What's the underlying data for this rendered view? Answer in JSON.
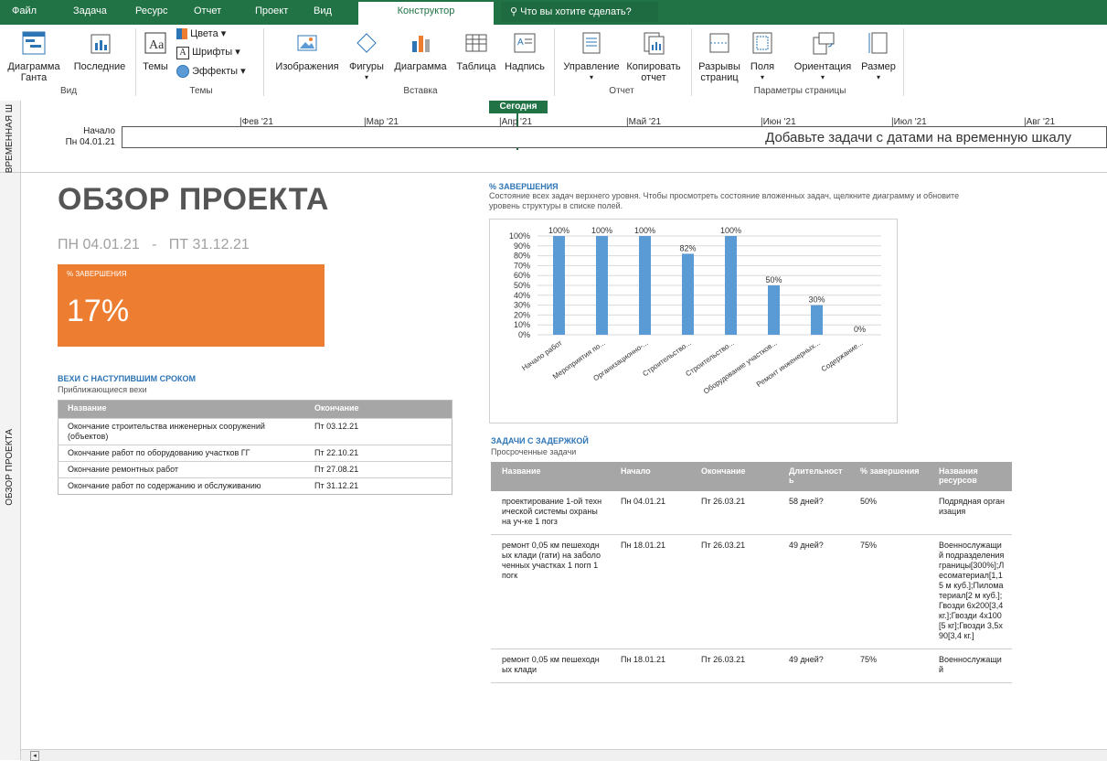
{
  "tabs": [
    "Файл",
    "Задача",
    "Ресурс",
    "Отчет",
    "Проект",
    "Вид",
    "Конструктор"
  ],
  "active_tab": "Конструктор",
  "tellme": "Что вы хотите сделать?",
  "ribbon": {
    "gantt": "Диаграмма Ганта",
    "recent": "Последние",
    "themes": "Темы",
    "colors": "Цвета",
    "fonts": "Шрифты",
    "effects": "Эффекты",
    "images": "Изображения",
    "shapes": "Фигуры",
    "chart": "Диаграмма",
    "table": "Таблица",
    "textbox": "Надпись",
    "manage": "Управление",
    "copy": "Копировать отчет",
    "breaks": "Разрывы страниц",
    "margins": "Поля",
    "orientation": "Ориентация",
    "size": "Размер",
    "groups": {
      "view": "Вид",
      "themes": "Темы",
      "insert": "Вставка",
      "report": "Отчет",
      "page": "Параметры страницы"
    }
  },
  "timeline": {
    "side_label": "ВРЕМЕННАЯ Ш",
    "today": "Сегодня",
    "start_label": "Начало",
    "start_date": "Пн 04.01.21",
    "months": [
      "Фев '21",
      "Мар '21",
      "Апр '21",
      "Май '21",
      "Июн '21",
      "Июл '21",
      "Авг '21"
    ],
    "placeholder": "Добавьте задачи с датами на временную шкалу"
  },
  "report": {
    "side_label": "ОБЗОР ПРОЕКТА",
    "title": "ОБЗОР ПРОЕКТА",
    "date_start": "ПН 04.01.21",
    "date_sep": "-",
    "date_end": "ПТ 31.12.21",
    "complete_label": "% ЗАВЕРШЕНИЯ",
    "complete_value": "17%",
    "accent_color": "#ed7d31",
    "milestones": {
      "title": "ВЕХИ С НАСТУПИВШИМ СРОКОМ",
      "subtitle": "Приближающиеся вехи",
      "headers": [
        "Название",
        "Окончание"
      ],
      "rows": [
        [
          "Окончание строительства инженерных сооружений (объектов)",
          "Пт 03.12.21"
        ],
        [
          "Окончание работ по оборудованию участков ГГ",
          "Пт 22.10.21"
        ],
        [
          "Окончание ремонтных работ",
          "Пт 27.08.21"
        ],
        [
          "Окончание работ по содержанию и обслуживанию",
          "Пт 31.12.21"
        ]
      ]
    },
    "chart_title": "% ЗАВЕРШЕНИЯ",
    "chart_desc": "Состояние всех задач верхнего уровня. Чтобы просмотреть состояние вложенных задач, щелкните диаграмму и обновите уровень структуры в списке полей.",
    "late": {
      "title": "ЗАДАЧИ С ЗАДЕРЖКОЙ",
      "subtitle": "Просроченные задачи",
      "headers": [
        "Название",
        "Начало",
        "Окончание",
        "Длительность",
        "% завершения",
        "Названия ресурсов"
      ],
      "rows": [
        [
          "проектирование 1-ой технической системы охраны на уч-ке 1 погз",
          "Пн 04.01.21",
          "Пт 26.03.21",
          "58 дней?",
          "50%",
          "Подрядная организация"
        ],
        [
          "ремонт  0,05 км пешеходных клади (гати) на заболоченных участках 1 погп 1 погк",
          "Пн 18.01.21",
          "Пт 26.03.21",
          "49 дней?",
          "75%",
          "Военнослужащий подразделения границы[300%];Лесоматериал[1,15 м куб.];Пиломатериал[2 м куб.];Гвозди 6х200[3,4 кг.];Гвозди 4х100[5 кг];Гвозди 3,5х90[3,4 кг.]"
        ],
        [
          "ремонт 0,05 км пешеходных клади",
          "Пн 18.01.21",
          "Пт 26.03.21",
          "49 дней?",
          "75%",
          "Военнослужащий"
        ]
      ]
    }
  },
  "chart_data": {
    "type": "bar",
    "title": "% ЗАВЕРШЕНИЯ",
    "categories": [
      "Начало работ",
      "Мероприятия по...",
      "Организационно-...",
      "Строительство...",
      "Строительство...",
      "Оборудование участков...",
      "Ремонт инженерных...",
      "Содержание..."
    ],
    "values": [
      100,
      100,
      100,
      82,
      100,
      50,
      30,
      0
    ],
    "value_labels": [
      "100%",
      "100%",
      "100%",
      "82%",
      "100%",
      "50%",
      "30%",
      "0%"
    ],
    "yticks": [
      "0%",
      "10%",
      "20%",
      "30%",
      "40%",
      "50%",
      "60%",
      "70%",
      "80%",
      "90%",
      "100%"
    ],
    "ylim": [
      0,
      100
    ],
    "bar_color": "#5b9bd5",
    "grid": true
  }
}
